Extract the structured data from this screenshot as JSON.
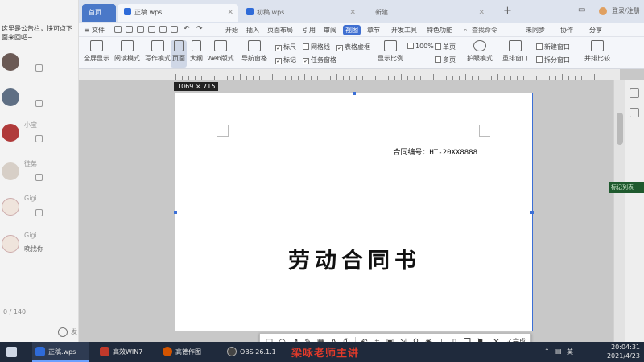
{
  "chat": {
    "notice": "这里是公告栏，快可点下面来回吧~",
    "rows": [
      {
        "name": "",
        "meta": ""
      },
      {
        "name": "",
        "meta": ""
      },
      {
        "name": "小宝",
        "meta": ""
      },
      {
        "name": "徒弟",
        "meta": ""
      },
      {
        "name": "Gigi",
        "meta": ""
      },
      {
        "name": "Gigi",
        "meta": "",
        "msg": "晚找你"
      }
    ],
    "counter": "0 / 140",
    "input_placeholder": "发"
  },
  "titlebar": {
    "tabs": [
      {
        "label": "首页",
        "kind": "home"
      },
      {
        "label": "正稿.wps",
        "kind": "doc"
      },
      {
        "label": "初稿.wps",
        "kind": "doc"
      },
      {
        "label": "新建",
        "kind": "new"
      }
    ],
    "right_label": "登录/注册"
  },
  "menubar": {
    "file_label": "文件",
    "items": [
      "开始",
      "插入",
      "页面布局",
      "引用",
      "审阅",
      "视图",
      "章节",
      "开发工具",
      "特色功能"
    ],
    "active_index": 5,
    "search_placeholder": "查找命令",
    "right_items": [
      "未同步",
      "协作",
      "分享"
    ]
  },
  "ribbon": {
    "big": [
      {
        "label": "全屏显示"
      },
      {
        "label": "阅读模式"
      },
      {
        "label": "写作模式"
      },
      {
        "label": "页面"
      },
      {
        "label": "大纲"
      },
      {
        "label": "Web版式"
      },
      {
        "label": "导航窗格"
      }
    ],
    "checks_row1": [
      {
        "label": "标尺",
        "checked": true
      },
      {
        "label": "网格线",
        "checked": false
      },
      {
        "label": "表格虚框",
        "checked": true
      }
    ],
    "checks_row2": [
      {
        "label": "标记",
        "checked": true
      },
      {
        "label": "任务窗格",
        "checked": true
      }
    ],
    "right_big": [
      {
        "label": "显示比例"
      },
      {
        "label": "护眼模式"
      },
      {
        "label": "重排窗口"
      },
      {
        "label": "并排比较"
      }
    ],
    "zoom_items": [
      "100%",
      "单页",
      "多页"
    ],
    "window_items": [
      "新建窗口",
      "拆分窗口"
    ]
  },
  "workspace": {
    "size_badge": "1069 × 715",
    "contract_no": "合同编号：HT-20XX8888",
    "doc_title": "劳动合同书",
    "green_tag": "标记列表"
  },
  "snip": {
    "done_label": "完成",
    "watermark": "梁咏老师主讲"
  },
  "taskbar": {
    "items": [
      {
        "label": "正稿.wps",
        "color": "#2f6bd8",
        "active": true
      },
      {
        "label": "高效WIN7",
        "color": "#c0392b",
        "active": false
      },
      {
        "label": "高德作图",
        "color": "#d35400",
        "active": false
      },
      {
        "label": "OBS 26.1.1",
        "color": "#444444",
        "active": false
      }
    ],
    "input_mode": "英",
    "time": "20:04:31",
    "date": "2021/4/23"
  },
  "colors": {
    "accent": "#3f6fd1",
    "taskbar": "#1f2a3c",
    "selection": "#3b6fd6",
    "watermark": "#e23a2a"
  }
}
